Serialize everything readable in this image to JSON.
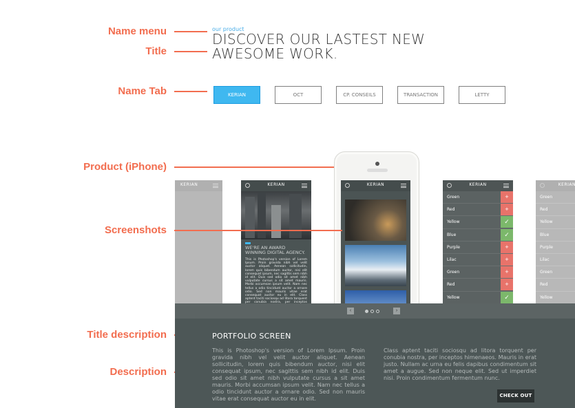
{
  "annotations": {
    "name_menu": "Name menu",
    "title": "Title",
    "name_tab": "Name Tab",
    "product": "Product (iPhone)",
    "screenshots": "Screenshots",
    "title_description": "Title  description",
    "description": "Description"
  },
  "header": {
    "name_menu": "our product",
    "title_line1": "DISCOVER OUR LASTEST NEW",
    "title_line2": "AWESOME WORK."
  },
  "tabs": [
    {
      "label": "KERIAN",
      "active": true
    },
    {
      "label": "OCT",
      "active": false
    },
    {
      "label": "CP. CONSEILS",
      "active": false
    },
    {
      "label": "TRANSACTION",
      "active": false
    },
    {
      "label": "LETTY",
      "active": false
    }
  ],
  "screens": {
    "app_name": "KERIAN",
    "article_heading": "WE'RE AN AWARD WINNING DIGITAL AGENCY.",
    "article_body": "This is Photoshop's version of Lorem Ipsum. Proin gravida nibh vel velit auctor aliquet. Aenean sollicitudin, lorem quis bibendum auctor, nisi elit consequat ipsum, nec sagittis sem nibh id elit. Duis sed odio sit amet nibh vulputate cursus a sit amet mauris. Morbi accumsan ipsum velit. Nam nec tellus a odio tincidunt auctor a ornare odio. Sed non mauris vitae erat consequat auctor eu in elit. Class aptent taciti sociosqu ad litora torquent per conubia nostra, per inceptos himenaeos.",
    "colors": [
      {
        "label": "Green",
        "state": "add"
      },
      {
        "label": "Red",
        "state": "add"
      },
      {
        "label": "Yellow",
        "state": "check"
      },
      {
        "label": "Blue",
        "state": "check"
      },
      {
        "label": "Purple",
        "state": "add"
      },
      {
        "label": "Lilac",
        "state": "add"
      },
      {
        "label": "Green",
        "state": "add"
      },
      {
        "label": "Red",
        "state": "add"
      },
      {
        "label": "Yellow",
        "state": "check"
      }
    ]
  },
  "pager": {
    "prev": "‹",
    "next": "›",
    "dots": 3,
    "active_index": 0
  },
  "portfolio": {
    "title": "PORTFOLIO SCREEN",
    "desc_left": "This is Photoshop's version  of Lorem Ipsum. Proin gravida nibh vel velit auctor aliquet. Aenean sollicitudin, lorem quis bibendum auctor, nisi elit consequat ipsum, nec sagittis sem nibh id elit. Duis sed odio sit amet nibh vulputate cursus a sit amet mauris. Morbi accumsan ipsum velit. Nam nec tellus a odio tincidunt auctor a ornare odio. Sed non  mauris vitae erat consequat auctor eu in elit.",
    "desc_right": "Class aptent taciti sociosqu ad litora torquent per conubia nostra, per inceptos himenaeos. Mauris in erat justo. Nullam ac urna eu felis dapibus condimentum sit amet a augue. Sed non neque elit. Sed ut imperdiet nisi. Proin condimentum fermentum nunc.",
    "cta": "CHECK OUT"
  },
  "colors": {
    "annotation": "#f26d4f",
    "tab_active": "#3fb8f0",
    "panel_bg": "#4d5757",
    "add_button": "#e8736a",
    "check_button": "#7cb86b"
  },
  "icons": {
    "add": "+",
    "check": "✓"
  }
}
